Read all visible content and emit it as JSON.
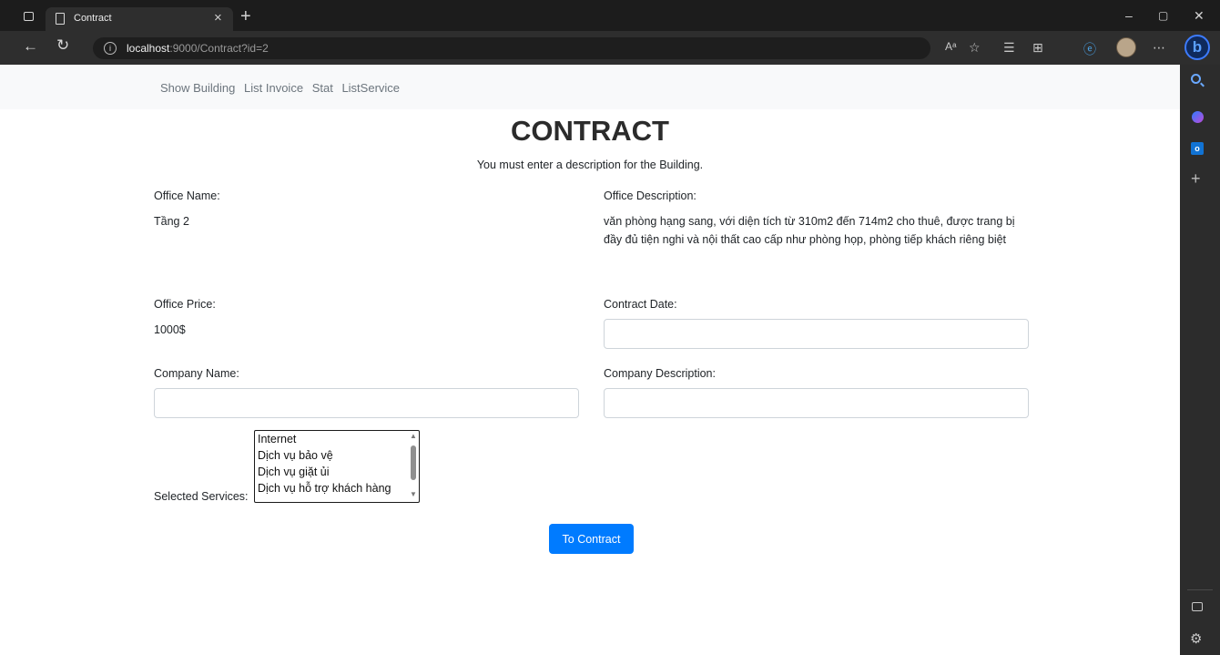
{
  "browser": {
    "tab_title": "Contract",
    "tab_close": "×",
    "new_tab": "+",
    "url_host": "localhost",
    "url_rest": ":9000/Contract?id=2",
    "read_aloud": "Aᵃ",
    "icons": [
      "page-icon",
      "back-icon",
      "refresh-icon",
      "info-icon",
      "favorites-icon",
      "collections-icon",
      "split-screen-icon",
      "profile-icon",
      "more-icon",
      "copilot-icon"
    ],
    "minimize": "–",
    "restore": "▢",
    "close": "✕"
  },
  "sidebar": {
    "icons": [
      "search-icon",
      "copilot-icon",
      "outlook-icon",
      "add-icon",
      "panel-icon",
      "settings-icon"
    ],
    "outlook_glyph": "o",
    "plus_glyph": "+",
    "gear_glyph": "⚙"
  },
  "nav": {
    "items": [
      "Show Building",
      "List Invoice",
      "Stat",
      "ListService"
    ]
  },
  "page": {
    "title": "CONTRACT",
    "subtitle": "You must enter a description for the Building."
  },
  "form": {
    "office_name_label": "Office Name:",
    "office_name_value": "Tầng 2",
    "office_description_label": "Office Description:",
    "office_description_value": "văn phòng hạng sang, với diện tích từ 310m2 đến 714m2 cho thuê, được trang bị đầy đủ tiện nghi và nội thất cao cấp như phòng họp, phòng tiếp khách riêng biệt",
    "office_price_label": "Office Price:",
    "office_price_value": "1000$",
    "contract_date_label": "Contract Date:",
    "contract_date_value": "",
    "company_name_label": "Company Name:",
    "company_name_value": "",
    "company_description_label": "Company Description:",
    "company_description_value": "",
    "selected_services_label": "Selected Services:",
    "services": [
      "Internet",
      "Dịch vụ bảo vệ",
      "Dịch vụ giặt ủi",
      "Dịch vụ hỗ trợ khách hàng"
    ],
    "submit_label": "To Contract"
  }
}
